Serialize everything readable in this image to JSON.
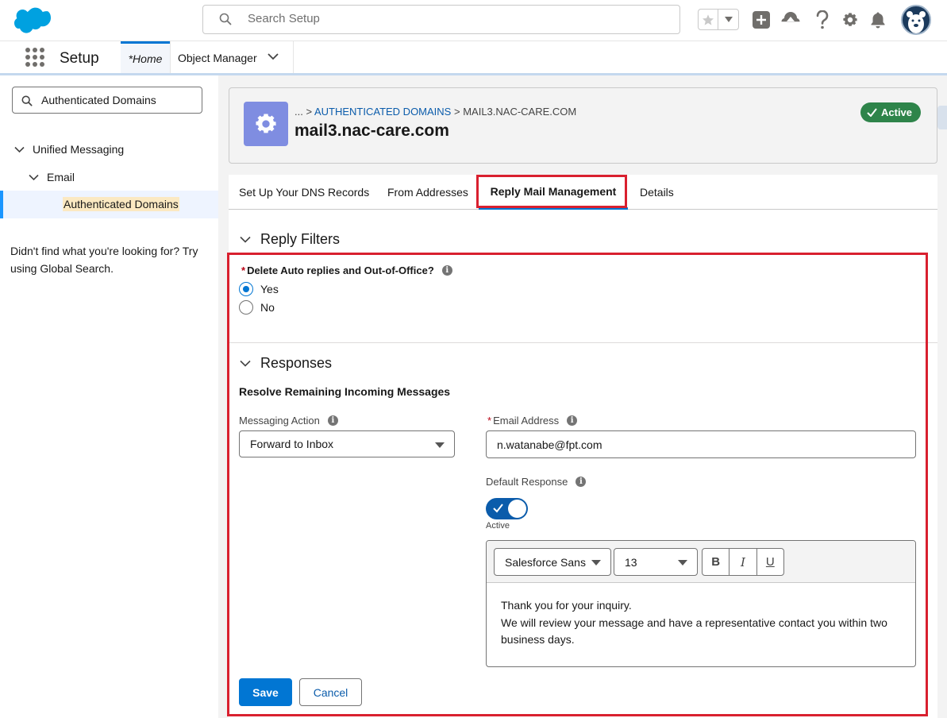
{
  "header": {
    "search_placeholder": "Search Setup"
  },
  "nav": {
    "app_name": "Setup",
    "tab_home": "*Home",
    "tab_object_manager": "Object Manager"
  },
  "sidebar": {
    "quickfind_value": "Authenticated Domains",
    "items": [
      {
        "label": "Unified Messaging"
      },
      {
        "label": "Email"
      },
      {
        "label": "Authenticated Domains"
      }
    ],
    "hint": "Didn't find what you're looking for? Try using Global Search."
  },
  "record": {
    "breadcrumb_ellipsis": "...",
    "breadcrumb_sep": ">",
    "breadcrumb_parent": "AUTHENTICATED DOMAINS",
    "breadcrumb_current": "MAIL3.NAC-CARE.COM",
    "title": "mail3.nac-care.com",
    "status": "Active"
  },
  "tabs": [
    {
      "label": "Set Up Your DNS Records"
    },
    {
      "label": "From Addresses"
    },
    {
      "label": "Reply Mail Management"
    },
    {
      "label": "Details"
    }
  ],
  "reply_filters": {
    "title": "Reply Filters",
    "question": "Delete Auto replies and Out-of-Office?",
    "options": [
      "Yes",
      "No"
    ],
    "selected": "Yes"
  },
  "responses": {
    "title": "Responses",
    "subheading": "Resolve Remaining Incoming Messages",
    "messaging_action_label": "Messaging Action",
    "messaging_action_value": "Forward to Inbox",
    "email_label": "Email Address",
    "email_value": "n.watanabe@fpt.com",
    "default_response_label": "Default Response",
    "default_response_state": "Active",
    "editor": {
      "font": "Salesforce Sans",
      "size": "13",
      "bold": "B",
      "italic": "I",
      "underline": "U",
      "line1": "Thank you for your inquiry.",
      "line2": "We will review your message and have a representative contact you within two business days."
    }
  },
  "actions": {
    "save": "Save",
    "cancel": "Cancel"
  },
  "colors": {
    "brand": "#0176d3",
    "annotation": "#d9202f",
    "success": "#2e844a"
  }
}
